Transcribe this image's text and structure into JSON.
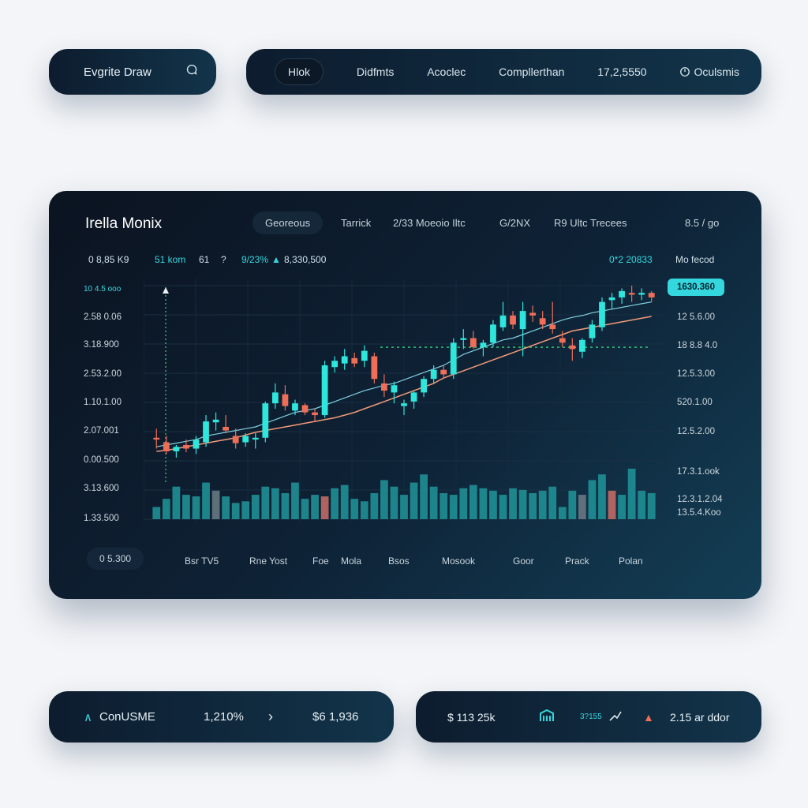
{
  "brand": {
    "name": "Evgrite Draw",
    "icon": "chat-bubble-icon"
  },
  "nav": {
    "items": [
      {
        "label": "Hlok",
        "active": true
      },
      {
        "label": "Didfmts"
      },
      {
        "label": "Acoclec"
      },
      {
        "label": "Compllerthan"
      },
      {
        "label": "17,2,5550"
      },
      {
        "label": "Oculsmis",
        "icon": "clock-icon"
      }
    ]
  },
  "panel": {
    "title": "Irella Monix",
    "tabs": [
      "Georeous",
      "Tarrick",
      "2/33  Moeoio Iltc",
      "G/2NX",
      "R9  Ultc Trecees"
    ],
    "price": "8.5 / go",
    "stats": [
      "0 8,85 K9",
      "51 kom",
      "61",
      "9/23%",
      "8,330,500"
    ],
    "stat_right": "0*2 20833",
    "stat_far": "Mo fecod",
    "y_left": [
      "10 4.5 ooo",
      "2.58 0.06",
      "3.18.900",
      "2.53.2.00",
      "1.10.1.00",
      "2.07.001",
      "0.00.500",
      "3.13.600",
      "1.33.500"
    ],
    "y_right": [
      "12 5.6.00",
      "18 8.8 4.0",
      "12.5.3.00",
      "520.1.00",
      "12.5.2.00",
      "17.3.1.ook",
      "12.3.1.2.04",
      "13.5.4.Koo"
    ],
    "badge": "1630.360",
    "timeframes": [
      "0 5.300",
      "Bsr TV5",
      "Rne Yost",
      "Foe",
      "Mola",
      "Bsos",
      "Mosook",
      "Goor",
      "Prack",
      "Polan"
    ]
  },
  "chart_data": {
    "type": "candlestick",
    "title": "Irella Monix",
    "candles": [
      {
        "o": 30,
        "h": 40,
        "l": 18,
        "c": 28
      },
      {
        "o": 25,
        "h": 32,
        "l": 12,
        "c": 15
      },
      {
        "o": 15,
        "h": 22,
        "l": 8,
        "c": 20
      },
      {
        "o": 22,
        "h": 28,
        "l": 14,
        "c": 18
      },
      {
        "o": 18,
        "h": 32,
        "l": 12,
        "c": 28
      },
      {
        "o": 25,
        "h": 55,
        "l": 20,
        "c": 48
      },
      {
        "o": 47,
        "h": 58,
        "l": 38,
        "c": 50
      },
      {
        "o": 42,
        "h": 55,
        "l": 35,
        "c": 38
      },
      {
        "o": 32,
        "h": 40,
        "l": 18,
        "c": 24
      },
      {
        "o": 25,
        "h": 35,
        "l": 20,
        "c": 32
      },
      {
        "o": 28,
        "h": 35,
        "l": 18,
        "c": 30
      },
      {
        "o": 30,
        "h": 70,
        "l": 25,
        "c": 68
      },
      {
        "o": 68,
        "h": 90,
        "l": 62,
        "c": 80
      },
      {
        "o": 78,
        "h": 88,
        "l": 60,
        "c": 65
      },
      {
        "o": 60,
        "h": 72,
        "l": 55,
        "c": 68
      },
      {
        "o": 66,
        "h": 68,
        "l": 55,
        "c": 58
      },
      {
        "o": 58,
        "h": 62,
        "l": 48,
        "c": 55
      },
      {
        "o": 55,
        "h": 115,
        "l": 52,
        "c": 110
      },
      {
        "o": 108,
        "h": 120,
        "l": 102,
        "c": 115
      },
      {
        "o": 112,
        "h": 128,
        "l": 105,
        "c": 120
      },
      {
        "o": 118,
        "h": 124,
        "l": 108,
        "c": 112
      },
      {
        "o": 115,
        "h": 132,
        "l": 108,
        "c": 126
      },
      {
        "o": 120,
        "h": 124,
        "l": 90,
        "c": 95
      },
      {
        "o": 90,
        "h": 100,
        "l": 75,
        "c": 82
      },
      {
        "o": 80,
        "h": 92,
        "l": 68,
        "c": 88
      },
      {
        "o": 65,
        "h": 72,
        "l": 55,
        "c": 68
      },
      {
        "o": 70,
        "h": 82,
        "l": 62,
        "c": 80
      },
      {
        "o": 80,
        "h": 98,
        "l": 75,
        "c": 95
      },
      {
        "o": 95,
        "h": 110,
        "l": 90,
        "c": 105
      },
      {
        "o": 105,
        "h": 110,
        "l": 95,
        "c": 100
      },
      {
        "o": 100,
        "h": 140,
        "l": 95,
        "c": 135
      },
      {
        "o": 138,
        "h": 150,
        "l": 128,
        "c": 140
      },
      {
        "o": 140,
        "h": 148,
        "l": 128,
        "c": 130
      },
      {
        "o": 130,
        "h": 138,
        "l": 120,
        "c": 135
      },
      {
        "o": 135,
        "h": 160,
        "l": 130,
        "c": 155
      },
      {
        "o": 152,
        "h": 180,
        "l": 148,
        "c": 165
      },
      {
        "o": 165,
        "h": 170,
        "l": 150,
        "c": 155
      },
      {
        "o": 150,
        "h": 180,
        "l": 120,
        "c": 170
      },
      {
        "o": 168,
        "h": 176,
        "l": 158,
        "c": 165
      },
      {
        "o": 162,
        "h": 170,
        "l": 150,
        "c": 155
      },
      {
        "o": 155,
        "h": 180,
        "l": 145,
        "c": 150
      },
      {
        "o": 140,
        "h": 148,
        "l": 130,
        "c": 135
      },
      {
        "o": 132,
        "h": 140,
        "l": 115,
        "c": 128
      },
      {
        "o": 125,
        "h": 140,
        "l": 118,
        "c": 138
      },
      {
        "o": 140,
        "h": 160,
        "l": 135,
        "c": 155
      },
      {
        "o": 152,
        "h": 185,
        "l": 148,
        "c": 180
      },
      {
        "o": 182,
        "h": 190,
        "l": 172,
        "c": 185
      },
      {
        "o": 185,
        "h": 195,
        "l": 178,
        "c": 192
      },
      {
        "o": 190,
        "h": 198,
        "l": 180,
        "c": 188
      },
      {
        "o": 188,
        "h": 195,
        "l": 182,
        "c": 190
      },
      {
        "o": 190,
        "h": 192,
        "l": 180,
        "c": 185
      }
    ],
    "volume": [
      15,
      25,
      40,
      30,
      28,
      45,
      35,
      28,
      20,
      22,
      30,
      40,
      38,
      32,
      45,
      25,
      30,
      28,
      38,
      42,
      25,
      22,
      32,
      48,
      40,
      30,
      45,
      55,
      40,
      32,
      30,
      38,
      42,
      38,
      35,
      30,
      38,
      36,
      32,
      35,
      40,
      15,
      35,
      30,
      48,
      55,
      35,
      30,
      62,
      35,
      32
    ],
    "ma_fast": [
      20,
      22,
      24,
      26,
      28,
      32,
      34,
      36,
      38,
      40,
      42,
      46,
      50,
      54,
      58,
      60,
      62,
      66,
      70,
      74,
      78,
      82,
      85,
      88,
      90,
      94,
      98,
      102,
      106,
      110,
      116,
      122,
      126,
      130,
      134,
      138,
      140,
      144,
      148,
      152,
      156,
      160,
      163,
      165,
      168,
      170,
      172,
      174,
      176,
      178,
      180
    ],
    "ma_slow": [
      15,
      16,
      18,
      20,
      22,
      24,
      26,
      28,
      30,
      33,
      36,
      38,
      40,
      42,
      44,
      46,
      48,
      50,
      52,
      55,
      58,
      62,
      66,
      70,
      74,
      78,
      82,
      86,
      90,
      96,
      100,
      104,
      108,
      112,
      116,
      120,
      124,
      128,
      132,
      136,
      140,
      144,
      148,
      150,
      152,
      154,
      156,
      158,
      160,
      162,
      164
    ],
    "dotted_level": 130,
    "colors": {
      "up": "#2ee6dc",
      "down": "#ef6e58",
      "ma_fast": "#7fd0e0",
      "ma_slow": "#f29a78"
    }
  },
  "bottom_left": {
    "label": "ConUSME",
    "percent": "1,210%",
    "value": "$6 1,936"
  },
  "bottom_right": {
    "value": "$ 113 25k",
    "small": "3?155",
    "change": "2.15 ar ddor"
  }
}
